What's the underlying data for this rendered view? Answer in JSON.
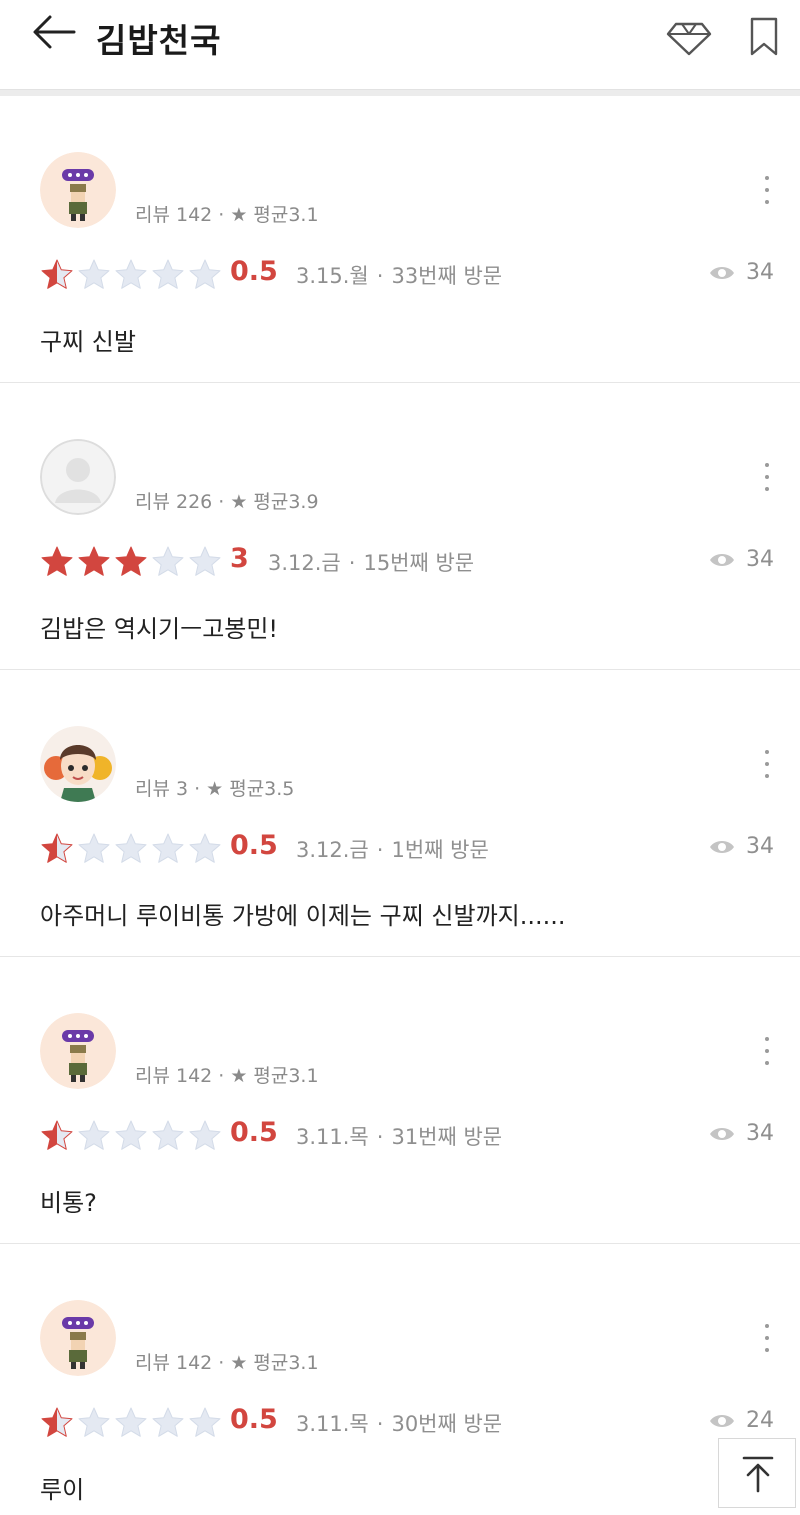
{
  "header": {
    "title": "김밥천국",
    "back_icon": "arrow-left-icon",
    "diamond_icon": "diamond-icon",
    "bookmark_icon": "bookmark-icon"
  },
  "colors": {
    "star_active": "#d2463f",
    "star_inactive": "#e4e9f2",
    "score": "#d2463f"
  },
  "reviews": [
    {
      "avatar": "sticker-avatar",
      "review_count": "리뷰 142",
      "average": "★ 평균3.1",
      "rating": 0.5,
      "score": "0.5",
      "date": "3.15.월",
      "visit": "33번째 방문",
      "views": "34",
      "text": "구찌 신발"
    },
    {
      "avatar": "default-avatar",
      "review_count": "리뷰 226",
      "average": "★ 평균3.9",
      "rating": 3,
      "score": "3",
      "date": "3.12.금",
      "visit": "15번째 방문",
      "views": "34",
      "text": "김밥은 역시기ㅡ고봉민!"
    },
    {
      "avatar": "cartoon-avatar",
      "review_count": "리뷰 3",
      "average": "★ 평균3.5",
      "rating": 0.5,
      "score": "0.5",
      "date": "3.12.금",
      "visit": "1번째 방문",
      "views": "34",
      "text": "아주머니 루이비통 가방에 이제는 구찌 신발까지......"
    },
    {
      "avatar": "sticker-avatar",
      "review_count": "리뷰 142",
      "average": "★ 평균3.1",
      "rating": 0.5,
      "score": "0.5",
      "date": "3.11.목",
      "visit": "31번째 방문",
      "views": "34",
      "text": "비통?"
    },
    {
      "avatar": "sticker-avatar",
      "review_count": "리뷰 142",
      "average": "★ 평균3.1",
      "rating": 0.5,
      "score": "0.5",
      "date": "3.11.목",
      "visit": "30번째 방문",
      "views": "24",
      "text": "루이"
    }
  ],
  "scroll_top_icon": "arrow-up-to-top-icon"
}
